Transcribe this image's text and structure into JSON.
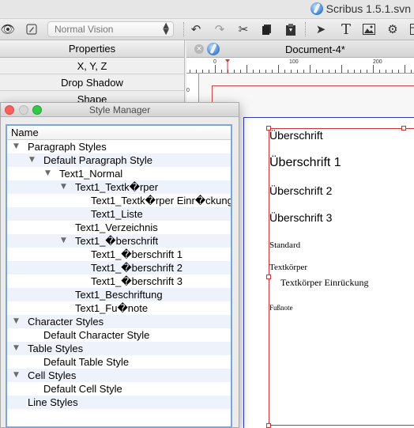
{
  "app": {
    "title": "Scribus 1.5.1.svn"
  },
  "toolbar": {
    "vision_mode": "Normal Vision"
  },
  "properties": {
    "title": "Properties",
    "rows": [
      "X, Y, Z",
      "Drop Shadow",
      "Shape"
    ]
  },
  "document": {
    "tab_title": "Document-4*",
    "ruler_labels": [
      "0",
      "100",
      "200"
    ],
    "text_lines": [
      "Überschrift",
      "Überschrift 1",
      "Überschrift 2",
      "Überschrift 3",
      "Standard",
      "Textkörper",
      "Textkörper Einrückung",
      "Fußnote"
    ]
  },
  "style_manager": {
    "title": "Style Manager",
    "column_header": "Name",
    "tree": [
      {
        "label": "Paragraph Styles",
        "level": 0,
        "expanded": true
      },
      {
        "label": "Default Paragraph Style",
        "level": 1,
        "expanded": true
      },
      {
        "label": "Text1_Normal",
        "level": 2,
        "expanded": true
      },
      {
        "label": "Text1_Textk�rper",
        "level": 3,
        "expanded": true
      },
      {
        "label": "Text1_Textk�rper Einr�ckung",
        "level": 4,
        "expanded": null
      },
      {
        "label": "Text1_Liste",
        "level": 4,
        "expanded": null
      },
      {
        "label": "Text1_Verzeichnis",
        "level": 3,
        "expanded": null
      },
      {
        "label": "Text1_�berschrift",
        "level": 3,
        "expanded": true
      },
      {
        "label": "Text1_�berschrift 1",
        "level": 4,
        "expanded": null
      },
      {
        "label": "Text1_�berschrift 2",
        "level": 4,
        "expanded": null
      },
      {
        "label": "Text1_�berschrift 3",
        "level": 4,
        "expanded": null
      },
      {
        "label": "Text1_Beschriftung",
        "level": 3,
        "expanded": null
      },
      {
        "label": "Text1_Fu�note",
        "level": 3,
        "expanded": null
      },
      {
        "label": "Character Styles",
        "level": 0,
        "expanded": true
      },
      {
        "label": "Default Character Style",
        "level": 1,
        "expanded": null
      },
      {
        "label": "Table Styles",
        "level": 0,
        "expanded": true
      },
      {
        "label": "Default Table Style",
        "level": 1,
        "expanded": null
      },
      {
        "label": "Cell Styles",
        "level": 0,
        "expanded": true
      },
      {
        "label": "Default Cell Style",
        "level": 1,
        "expanded": null
      },
      {
        "label": "Line Styles",
        "level": 0,
        "expanded": null
      }
    ]
  },
  "colors": {
    "selection_border": "#7aa7e0",
    "frame_red": "#cc3333",
    "page_blue": "#2a3dc9",
    "alt_row": "#eef3fb"
  }
}
